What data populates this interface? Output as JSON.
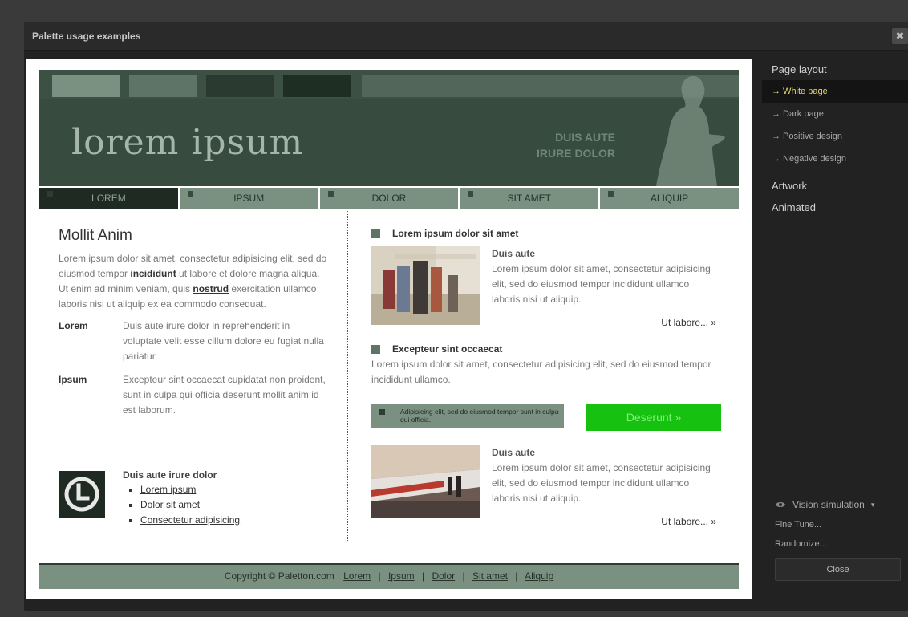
{
  "dialog": {
    "title": "Palette usage examples",
    "close_glyph": "✖"
  },
  "colors": {
    "darkest": "#1e2a22",
    "dark": "#384b3f",
    "mid": "#52665a",
    "light": "#7a9080",
    "lighter": "#8a9f90",
    "accent_green": "#17c10f",
    "highlight_yellow": "#e7d66f"
  },
  "preview": {
    "logo": "lorem ipsum",
    "tagline_1": "DUIS AUTE",
    "tagline_2": "IRURE DOLOR",
    "nav": [
      "LOREM",
      "IPSUM",
      "DOLOR",
      "SIT AMET",
      "ALIQUIP"
    ],
    "left": {
      "heading": "Mollit Anim",
      "para_1": "Lorem ipsum dolor sit amet, consectetur adipisicing elit, sed do eiusmod tempor ",
      "link_1": "incididunt",
      "para_2": " ut labore et dolore magna aliqua. Ut enim ad minim veniam, quis ",
      "link_2": "nostrud",
      "para_3": " exercitation ullamco laboris nisi ut aliquip ex ea commodo consequat.",
      "defs": [
        {
          "term": "Lorem",
          "desc": "Duis aute irure dolor in reprehenderit in voluptate velit esse cillum dolore eu fugiat nulla pariatur."
        },
        {
          "term": "Ipsum",
          "desc": "Excepteur sint occaecat cupidatat non proident, sunt in culpa qui officia deserunt mollit anim id est laborum."
        }
      ],
      "list_title": "Duis aute irure dolor",
      "list": [
        "Lorem ipsum",
        "Dolor sit amet",
        "Consectetur adipisicing"
      ]
    },
    "right": {
      "section_1": "Lorem ipsum dolor sit amet",
      "article_1_title": "Duis aute",
      "article_1_text": "Lorem ipsum dolor sit amet, consectetur adipisicing elit, sed do eiusmod tempor incididunt ullamco laboris nisi ut aliquip.",
      "article_1_more": "Ut labore... »",
      "section_2": "Excepteur sint occaecat",
      "section_2_text": "Lorem ipsum dolor sit amet, consectetur adipisicing elit, sed do eiusmod tempor incididunt ullamco.",
      "note": "Adipisicing elit, sed do eiusmod tempor sunt in culpa qui officia.",
      "cta": "Deserunt »",
      "article_2_title": "Duis aute",
      "article_2_text": "Lorem ipsum dolor sit amet, consectetur adipisicing elit, sed do eiusmod tempor incididunt ullamco laboris nisi ut aliquip.",
      "article_2_more": "Ut labore... »"
    },
    "footer": {
      "copyright": "Copyright © Paletton.com",
      "links": [
        "Lorem",
        "Ipsum",
        "Dolor",
        "Sit amet",
        "Aliquip"
      ],
      "separator": "|"
    }
  },
  "side": {
    "heading_layout": "Page layout",
    "layout_items": [
      "→ White page",
      "→ Dark page",
      "→ Positive design",
      "→ Negative design"
    ],
    "heading_artwork": "Artwork",
    "heading_animated": "Animated",
    "vision": "Vision simulation",
    "vision_caret": "▾",
    "fine_tune": "Fine Tune...",
    "randomize": "Randomize...",
    "close": "Close"
  }
}
